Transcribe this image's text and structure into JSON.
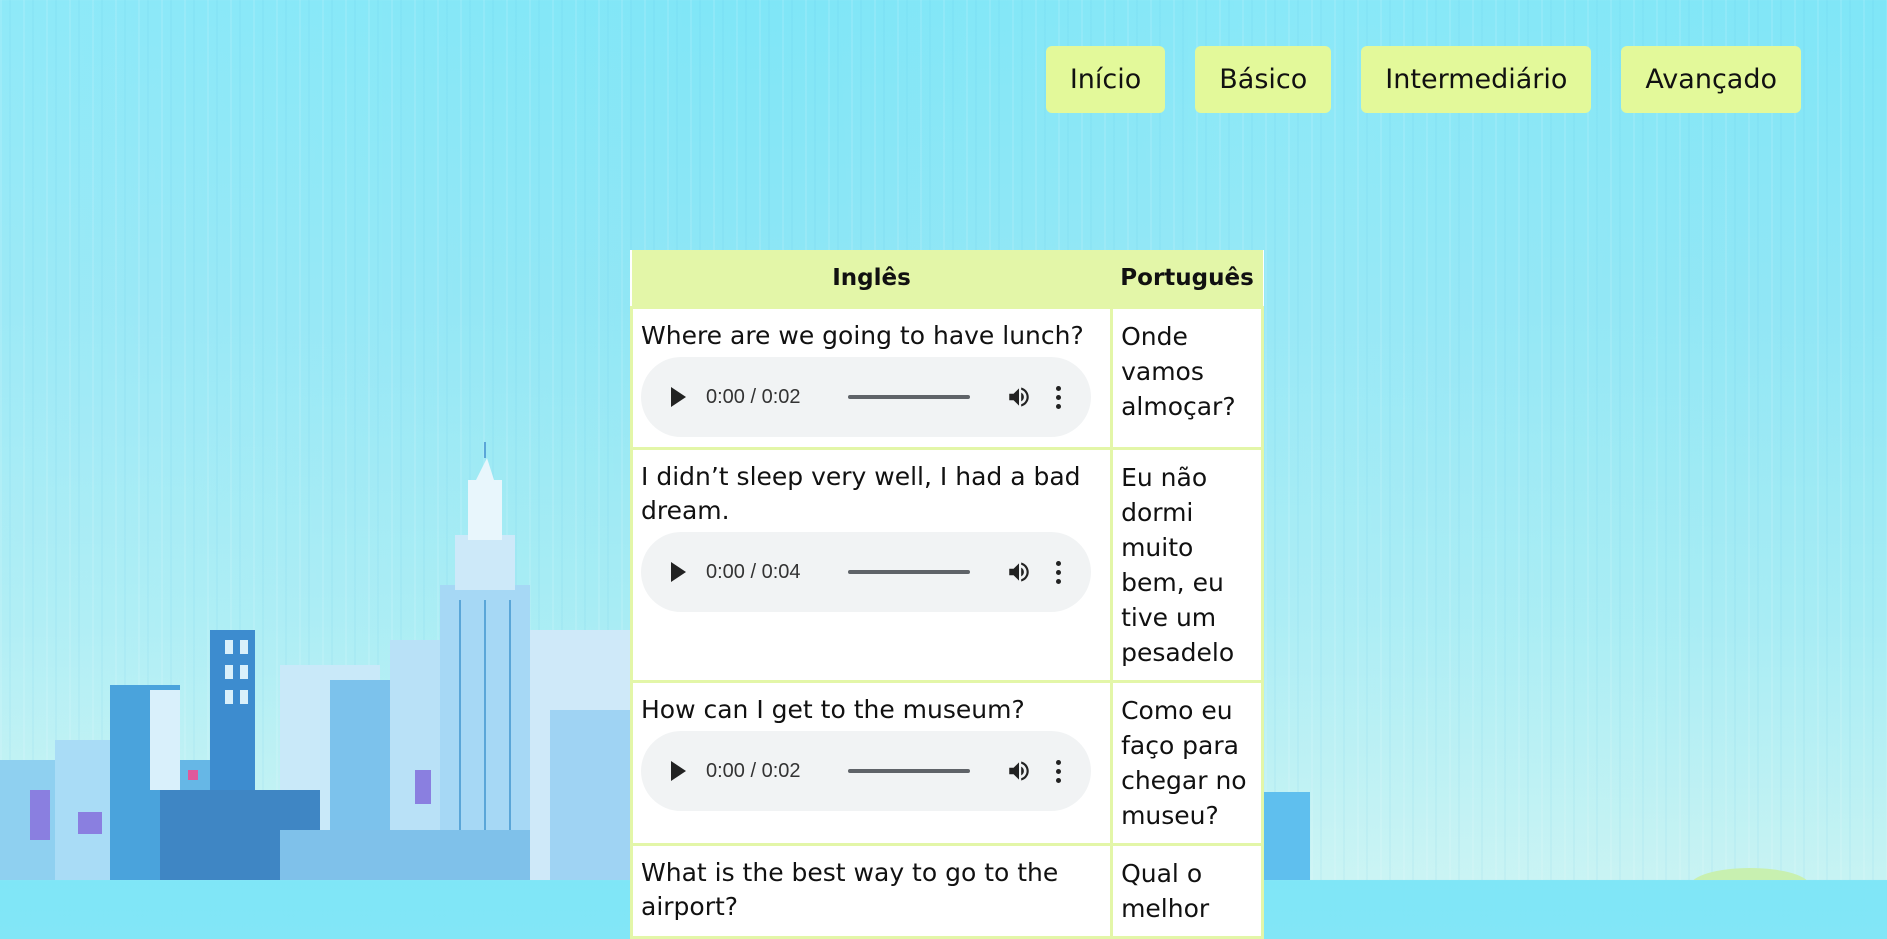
{
  "nav": {
    "items": [
      {
        "label": "Início"
      },
      {
        "label": "Básico"
      },
      {
        "label": "Intermediário"
      },
      {
        "label": "Avançado"
      }
    ]
  },
  "table": {
    "headers": {
      "english": "Inglês",
      "portuguese": "Português"
    },
    "rows": [
      {
        "english": "Where are we going to have lunch?",
        "audio_time": "0:00 / 0:02",
        "portuguese": "Onde vamos almoçar?"
      },
      {
        "english": "I didn’t sleep very well, I had a bad dream.",
        "audio_time": "0:00 / 0:04",
        "portuguese": "Eu não dormi muito bem, eu tive um pesadelo"
      },
      {
        "english": "How can I get to the museum?",
        "audio_time": "0:00 / 0:02",
        "portuguese": "Como eu faço para chegar no museu?"
      },
      {
        "english": "What is the best way to go to the airport?",
        "audio_time": "",
        "portuguese": "Qual o melhor"
      }
    ]
  },
  "colors": {
    "nav_button_bg": "#e3f99a",
    "table_header_bg": "#e3f6a8",
    "audio_bg": "#f1f3f4"
  },
  "icons": [
    "play-icon",
    "volume-icon",
    "more-options-icon"
  ]
}
